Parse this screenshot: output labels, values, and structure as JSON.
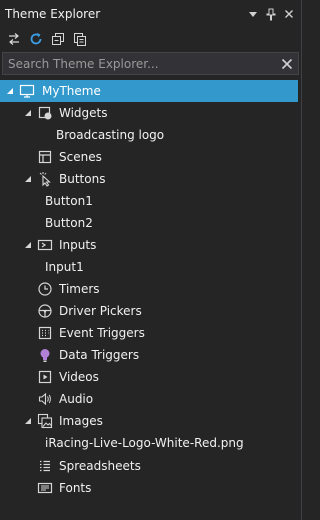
{
  "panel": {
    "title": "Theme Explorer",
    "search_placeholder": "Search Theme Explorer..."
  },
  "toolbar": {
    "buttons": [
      "sync-icon",
      "refresh-icon",
      "collapse-all-icon",
      "copy-icon"
    ]
  },
  "tree": {
    "root": "MyTheme",
    "widgets": "Widgets",
    "broadcasting_logo": "Broadcasting logo",
    "scenes": "Scenes",
    "buttons": "Buttons",
    "button1": "Button1",
    "button2": "Button2",
    "inputs": "Inputs",
    "input1": "Input1",
    "timers": "Timers",
    "driver_pickers": "Driver Pickers",
    "event_triggers": "Event Triggers",
    "data_triggers": "Data Triggers",
    "videos": "Videos",
    "audio": "Audio",
    "images": "Images",
    "image_file": "iRacing-Live-Logo-White-Red.png",
    "spreadsheets": "Spreadsheets",
    "fonts": "Fonts"
  },
  "colors": {
    "background": "#252526",
    "selected": "#3399cc",
    "text": "#f1f1f1",
    "accent_refresh": "#3c9de3",
    "data_trigger": "#b180d7"
  }
}
